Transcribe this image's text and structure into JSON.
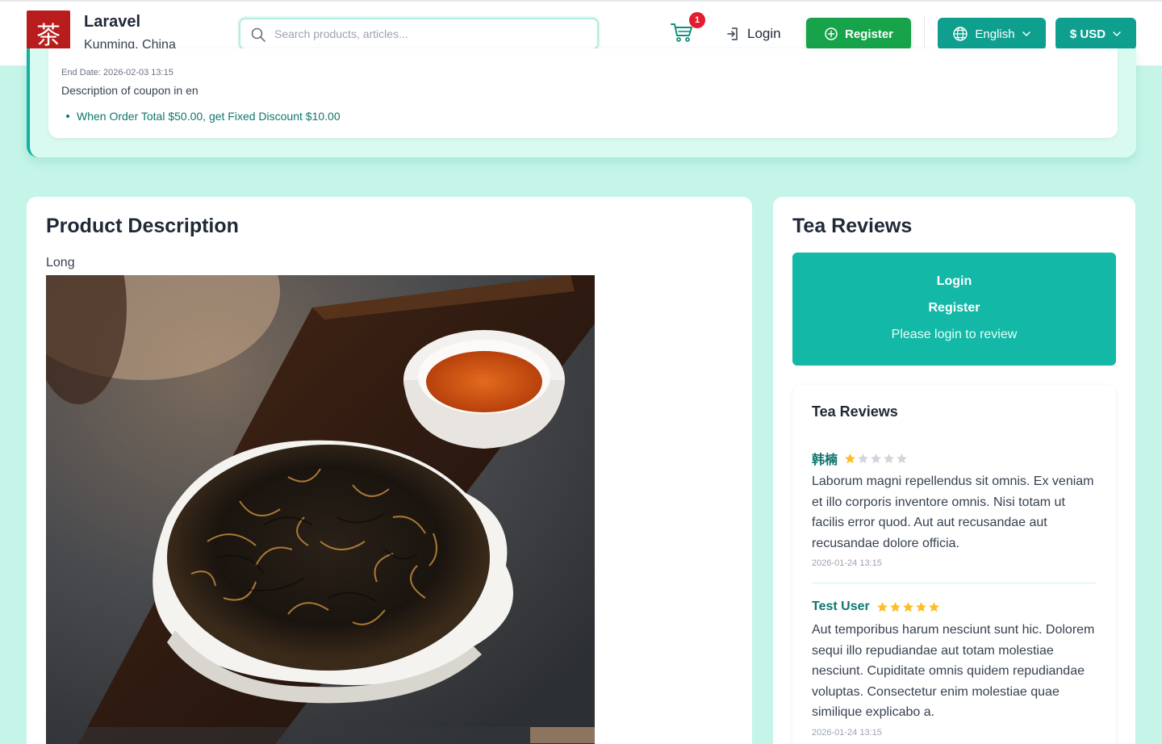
{
  "header": {
    "logo_char": "茶",
    "site_name": "Laravel",
    "location": "Kunming, China",
    "search_placeholder": "Search products, articles...",
    "cart_count": "1",
    "login_label": "Login",
    "register_label": "Register",
    "language_label": "English",
    "currency_label": "$ USD"
  },
  "coupon": {
    "end_date": "End Date: 2026-02-03 13:15",
    "description": "Description of coupon in en",
    "rules": [
      "When Order Total $50.00, get Fixed Discount $10.00"
    ]
  },
  "product_description": {
    "title": "Product Description",
    "text": "Long"
  },
  "reviews": {
    "title": "Tea Reviews",
    "login_label": "Login",
    "register_label": "Register",
    "login_prompt": "Please login to review",
    "list_title": "Tea Reviews",
    "items": [
      {
        "author": "韩楠",
        "rating": 1,
        "text": "Laborum magni repellendus sit omnis. Ex veniam et illo corporis inventore omnis. Nisi totam ut facilis error quod. Aut aut recusandae aut recusandae dolore officia.",
        "date": "2026-01-24 13:15"
      },
      {
        "author": "Test User",
        "rating": 5,
        "text": "Aut temporibus harum nesciunt sunt hic. Dolorem sequi illo repudiandae aut totam molestiae nesciunt. Cupiditate omnis quidem repudiandae voluptas. Consectetur enim molestiae quae similique explicabo a.",
        "date": "2026-01-24 13:15"
      }
    ]
  },
  "colors": {
    "brand_teal": "#0f9f8f",
    "register_green": "#16a34a",
    "star_filled": "#fbbf24",
    "star_empty": "#d1d5db"
  }
}
